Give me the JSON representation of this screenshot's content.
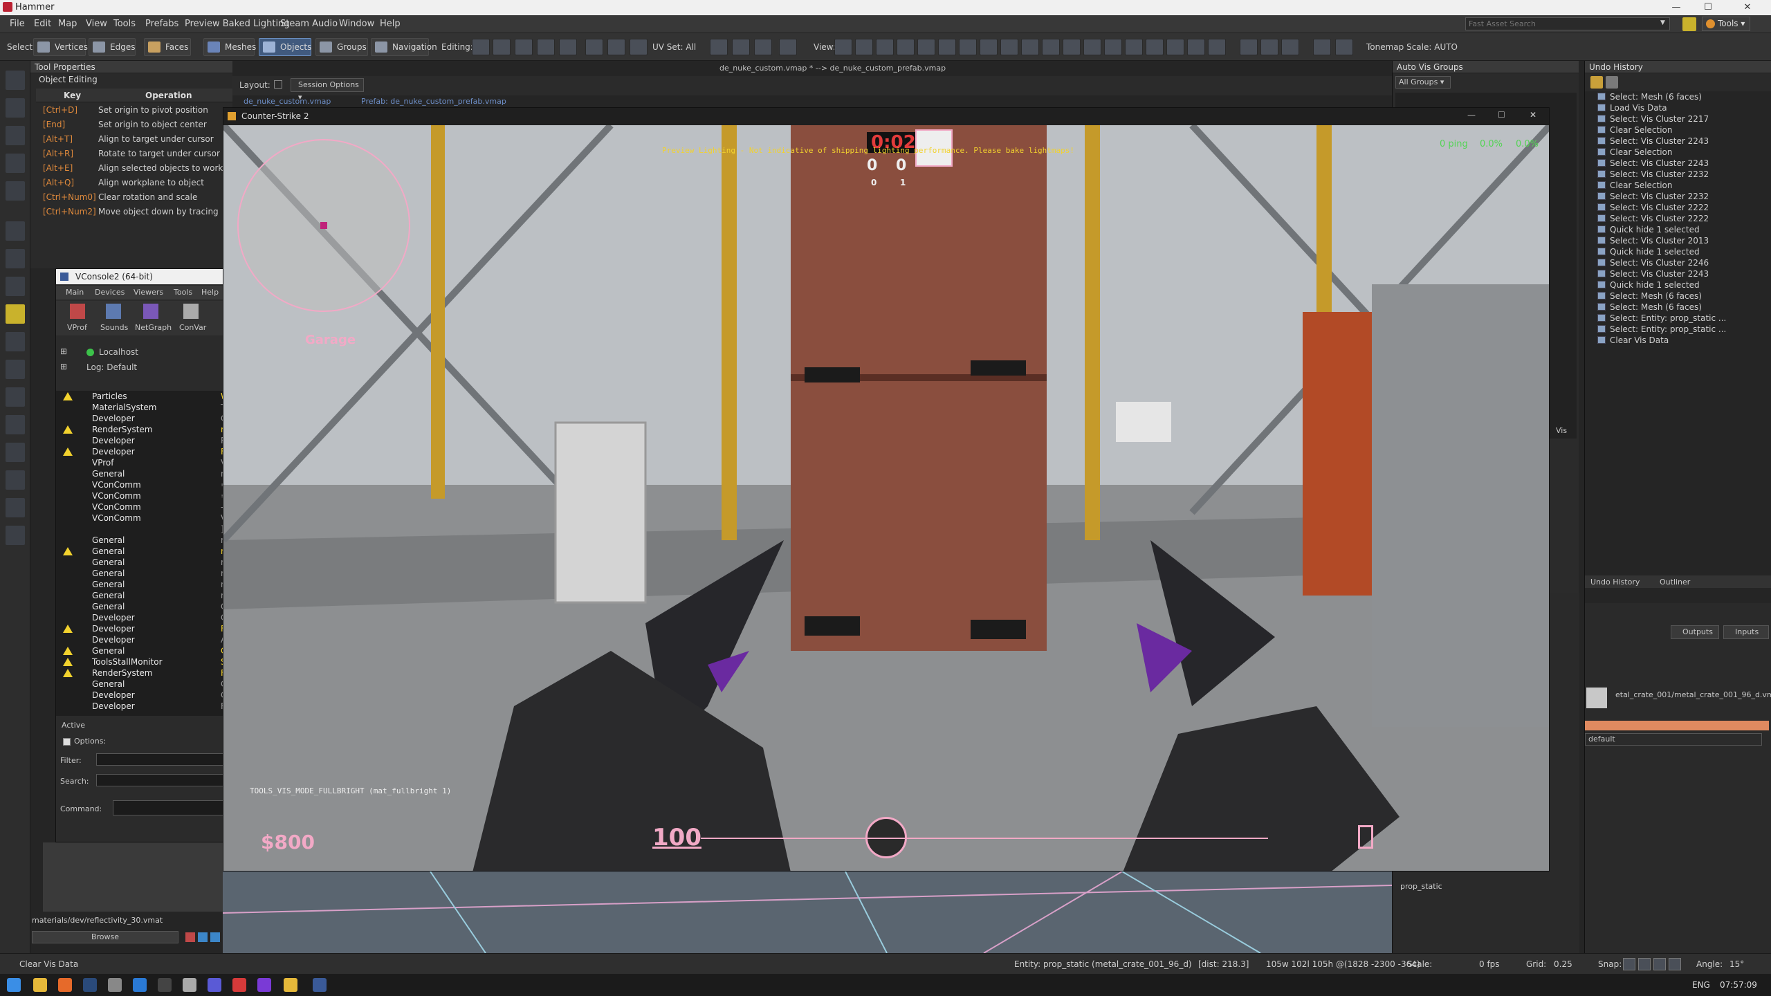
{
  "app": {
    "title": "Hammer"
  },
  "menu": [
    "File",
    "Edit",
    "Map",
    "View",
    "Tools",
    "Prefabs",
    "Preview Baked Lighting",
    "Steam Audio",
    "Window",
    "Help"
  ],
  "search": {
    "placeholder": "Fast Asset Search"
  },
  "tools_label": "Tools",
  "toolbar": {
    "select_label": "Select:",
    "select_modes": [
      "Vertices",
      "Edges",
      "Faces",
      "Meshes",
      "Objects",
      "Groups",
      "Navigation"
    ],
    "editing_label": "Editing:",
    "uvset": "UV Set: All",
    "view_label": "View:",
    "tonemap": "Tonemap Scale: AUTO"
  },
  "tool_properties": {
    "title": "Tool Properties",
    "section": "Object Editing",
    "col_key": "Key",
    "col_op": "Operation",
    "rows": [
      {
        "key": "[Ctrl+D]",
        "op": "Set origin to pivot position"
      },
      {
        "key": "[End]",
        "op": "Set origin to object center"
      },
      {
        "key": "[Alt+T]",
        "op": "Align to target under cursor"
      },
      {
        "key": "[Alt+R]",
        "op": "Rotate to target under cursor"
      },
      {
        "key": "[Alt+E]",
        "op": "Align selected objects to workplane"
      },
      {
        "key": "[Alt+Q]",
        "op": "Align workplane to object"
      },
      {
        "key": "[Ctrl+Num0]",
        "op": "Clear rotation and scale"
      },
      {
        "key": "[Ctrl+Num2]",
        "op": "Move object down by tracing"
      }
    ]
  },
  "layout": {
    "label": "Layout:",
    "session": "Session Options"
  },
  "doc_title": "de_nuke_custom.vmap * --> de_nuke_custom_prefab.vmap",
  "tabs": [
    "de_nuke_custom.vmap",
    "Prefab: de_nuke_custom_prefab.vmap"
  ],
  "vconsole": {
    "title": "VConsole2 (64-bit)",
    "menu": [
      "Main",
      "Devices",
      "Viewers",
      "Tools",
      "Help"
    ],
    "tools": [
      "VProf",
      "Sounds",
      "NetGraph",
      "ConVar"
    ],
    "host": "Localhost",
    "log": "Log: Default",
    "channels": [
      {
        "name": "Particles",
        "warn": true,
        "v": "WA"
      },
      {
        "name": "MaterialSystem",
        "warn": false,
        "v": "Te"
      },
      {
        "name": "Developer",
        "warn": false,
        "v": "Cr"
      },
      {
        "name": "RenderSystem",
        "warn": true,
        "v": "re"
      },
      {
        "name": "Developer",
        "warn": false,
        "v": "Re"
      },
      {
        "name": "Developer",
        "warn": true,
        "v": "Fa"
      },
      {
        "name": "VProf",
        "warn": false,
        "v": "VF"
      },
      {
        "name": "General",
        "warn": false,
        "v": "no"
      },
      {
        "name": "VConComm",
        "warn": false,
        "v": "=="
      },
      {
        "name": "VConComm",
        "warn": false,
        "v": "=="
      },
      {
        "name": "VConComm",
        "warn": false,
        "v": "--"
      },
      {
        "name": "VConComm",
        "warn": false,
        "v": "VC"
      },
      {
        "name": "",
        "warn": false,
        "v": "]"
      },
      {
        "name": "General",
        "warn": false,
        "v": "no"
      },
      {
        "name": "General",
        "warn": true,
        "v": "no"
      },
      {
        "name": "General",
        "warn": false,
        "v": "no"
      },
      {
        "name": "General",
        "warn": false,
        "v": "no"
      },
      {
        "name": "General",
        "warn": false,
        "v": "no"
      },
      {
        "name": "General",
        "warn": false,
        "v": "no"
      },
      {
        "name": "General",
        "warn": false,
        "v": "Ch"
      },
      {
        "name": "Developer",
        "warn": false,
        "v": "CC"
      },
      {
        "name": "Developer",
        "warn": true,
        "v": "Fa"
      },
      {
        "name": "Developer",
        "warn": false,
        "v": "Ad"
      },
      {
        "name": "General",
        "warn": true,
        "v": "CC"
      },
      {
        "name": "ToolsStallMonitor",
        "warn": true,
        "v": "St"
      },
      {
        "name": "RenderSystem",
        "warn": true,
        "v": "Fr"
      },
      {
        "name": "General",
        "warn": false,
        "v": "Ch"
      },
      {
        "name": "Developer",
        "warn": false,
        "v": "CC"
      },
      {
        "name": "Developer",
        "warn": false,
        "v": "Re"
      }
    ],
    "active_label": "Active",
    "options_label": "Options:",
    "filter_label": "Filter:",
    "search_label": "Search:",
    "command_label": "Command:"
  },
  "material_path": "materials/dev/reflectivity_30.vmat",
  "browse_label": "Browse",
  "game": {
    "title": "Counter-Strike 2",
    "timer": "0:02",
    "score_left": "0",
    "score_right": "0",
    "count_left": "0",
    "count_right": "1",
    "preview_text": "Preview Lighting - Not indicative of shipping lighting performance. Please bake lightmaps!",
    "ping": "0 ping",
    "loss1": "0.0%",
    "loss2": "0.0%",
    "location": "Garage",
    "cvar_text": "TOOLS_VIS_MODE_FULLBRIGHT (mat_fullbright 1)",
    "money": "$800",
    "health": "100"
  },
  "undo_history": {
    "title": "Undo History",
    "items": [
      "Select: Mesh (6 faces)",
      "Load Vis Data",
      "Select: Vis Cluster 2217",
      "Clear Selection",
      "Select: Vis Cluster 2243",
      "Clear Selection",
      "Select: Vis Cluster 2243",
      "Select: Vis Cluster 2232",
      "Clear Selection",
      "Select: Vis Cluster 2232",
      "Select: Vis Cluster 2222",
      "Select: Vis Cluster 2222",
      "Quick hide 1 selected",
      "Select: Vis Cluster 2013",
      "Quick hide 1 selected",
      "Select: Vis Cluster 2246",
      "Select: Vis Cluster 2243",
      "Quick hide 1 selected",
      "Select: Mesh (6 faces)",
      "Select: Mesh (6 faces)",
      "Select: Entity: prop_static ...",
      "Select: Entity: prop_static ...",
      "Clear Vis Data"
    ],
    "tab_undo": "Undo History",
    "tab_outliner": "Outliner"
  },
  "auto_vis": {
    "title": "Auto Vis Groups",
    "filter": "All Groups",
    "vis_label": "Vis"
  },
  "entity_panel": {
    "outputs": "Outputs",
    "inputs": "Inputs",
    "model": "etal_crate_001/metal_crate_001_96_d.vmdl",
    "skin": "default",
    "class": "prop_static"
  },
  "status": {
    "left": "Clear Vis Data",
    "entity": "Entity: prop_static (metal_crate_001_96_d)",
    "dist": "[dist: 218.3]",
    "dims": "105w 102l 105h @(1828 -2300 -364)",
    "scale": "Scale:",
    "fps": "0 fps",
    "grid_label": "Grid:",
    "grid_val": "0.25",
    "snap_label": "Snap:",
    "angle_label": "Angle:",
    "angle_val": "15°"
  },
  "taskbar": {
    "lang": "ENG",
    "time": "07:57:09"
  },
  "colors": {
    "accent": "#415a7e",
    "hud_pink": "#f2a9c6",
    "timer_red": "#e23b3b",
    "warn": "#f2d22e",
    "key_orange": "#e08a3c"
  }
}
